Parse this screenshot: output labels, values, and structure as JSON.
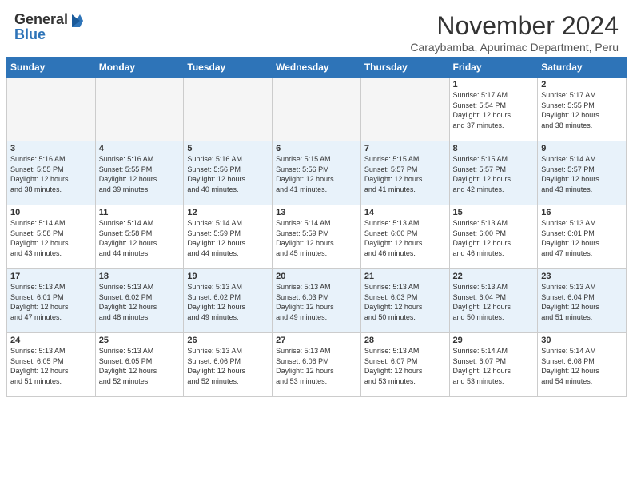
{
  "header": {
    "logo_general": "General",
    "logo_blue": "Blue",
    "title": "November 2024",
    "location": "Caraybamba, Apurimac Department, Peru"
  },
  "weekdays": [
    "Sunday",
    "Monday",
    "Tuesday",
    "Wednesday",
    "Thursday",
    "Friday",
    "Saturday"
  ],
  "weeks": [
    [
      {
        "day": "",
        "sunrise": "",
        "sunset": "",
        "daylight": ""
      },
      {
        "day": "",
        "sunrise": "",
        "sunset": "",
        "daylight": ""
      },
      {
        "day": "",
        "sunrise": "",
        "sunset": "",
        "daylight": ""
      },
      {
        "day": "",
        "sunrise": "",
        "sunset": "",
        "daylight": ""
      },
      {
        "day": "",
        "sunrise": "",
        "sunset": "",
        "daylight": ""
      },
      {
        "day": "1",
        "sunrise": "Sunrise: 5:17 AM",
        "sunset": "Sunset: 5:54 PM",
        "daylight": "Daylight: 12 hours and 37 minutes."
      },
      {
        "day": "2",
        "sunrise": "Sunrise: 5:17 AM",
        "sunset": "Sunset: 5:55 PM",
        "daylight": "Daylight: 12 hours and 38 minutes."
      }
    ],
    [
      {
        "day": "3",
        "sunrise": "Sunrise: 5:16 AM",
        "sunset": "Sunset: 5:55 PM",
        "daylight": "Daylight: 12 hours and 38 minutes."
      },
      {
        "day": "4",
        "sunrise": "Sunrise: 5:16 AM",
        "sunset": "Sunset: 5:55 PM",
        "daylight": "Daylight: 12 hours and 39 minutes."
      },
      {
        "day": "5",
        "sunrise": "Sunrise: 5:16 AM",
        "sunset": "Sunset: 5:56 PM",
        "daylight": "Daylight: 12 hours and 40 minutes."
      },
      {
        "day": "6",
        "sunrise": "Sunrise: 5:15 AM",
        "sunset": "Sunset: 5:56 PM",
        "daylight": "Daylight: 12 hours and 41 minutes."
      },
      {
        "day": "7",
        "sunrise": "Sunrise: 5:15 AM",
        "sunset": "Sunset: 5:57 PM",
        "daylight": "Daylight: 12 hours and 41 minutes."
      },
      {
        "day": "8",
        "sunrise": "Sunrise: 5:15 AM",
        "sunset": "Sunset: 5:57 PM",
        "daylight": "Daylight: 12 hours and 42 minutes."
      },
      {
        "day": "9",
        "sunrise": "Sunrise: 5:14 AM",
        "sunset": "Sunset: 5:57 PM",
        "daylight": "Daylight: 12 hours and 43 minutes."
      }
    ],
    [
      {
        "day": "10",
        "sunrise": "Sunrise: 5:14 AM",
        "sunset": "Sunset: 5:58 PM",
        "daylight": "Daylight: 12 hours and 43 minutes."
      },
      {
        "day": "11",
        "sunrise": "Sunrise: 5:14 AM",
        "sunset": "Sunset: 5:58 PM",
        "daylight": "Daylight: 12 hours and 44 minutes."
      },
      {
        "day": "12",
        "sunrise": "Sunrise: 5:14 AM",
        "sunset": "Sunset: 5:59 PM",
        "daylight": "Daylight: 12 hours and 44 minutes."
      },
      {
        "day": "13",
        "sunrise": "Sunrise: 5:14 AM",
        "sunset": "Sunset: 5:59 PM",
        "daylight": "Daylight: 12 hours and 45 minutes."
      },
      {
        "day": "14",
        "sunrise": "Sunrise: 5:13 AM",
        "sunset": "Sunset: 6:00 PM",
        "daylight": "Daylight: 12 hours and 46 minutes."
      },
      {
        "day": "15",
        "sunrise": "Sunrise: 5:13 AM",
        "sunset": "Sunset: 6:00 PM",
        "daylight": "Daylight: 12 hours and 46 minutes."
      },
      {
        "day": "16",
        "sunrise": "Sunrise: 5:13 AM",
        "sunset": "Sunset: 6:01 PM",
        "daylight": "Daylight: 12 hours and 47 minutes."
      }
    ],
    [
      {
        "day": "17",
        "sunrise": "Sunrise: 5:13 AM",
        "sunset": "Sunset: 6:01 PM",
        "daylight": "Daylight: 12 hours and 47 minutes."
      },
      {
        "day": "18",
        "sunrise": "Sunrise: 5:13 AM",
        "sunset": "Sunset: 6:02 PM",
        "daylight": "Daylight: 12 hours and 48 minutes."
      },
      {
        "day": "19",
        "sunrise": "Sunrise: 5:13 AM",
        "sunset": "Sunset: 6:02 PM",
        "daylight": "Daylight: 12 hours and 49 minutes."
      },
      {
        "day": "20",
        "sunrise": "Sunrise: 5:13 AM",
        "sunset": "Sunset: 6:03 PM",
        "daylight": "Daylight: 12 hours and 49 minutes."
      },
      {
        "day": "21",
        "sunrise": "Sunrise: 5:13 AM",
        "sunset": "Sunset: 6:03 PM",
        "daylight": "Daylight: 12 hours and 50 minutes."
      },
      {
        "day": "22",
        "sunrise": "Sunrise: 5:13 AM",
        "sunset": "Sunset: 6:04 PM",
        "daylight": "Daylight: 12 hours and 50 minutes."
      },
      {
        "day": "23",
        "sunrise": "Sunrise: 5:13 AM",
        "sunset": "Sunset: 6:04 PM",
        "daylight": "Daylight: 12 hours and 51 minutes."
      }
    ],
    [
      {
        "day": "24",
        "sunrise": "Sunrise: 5:13 AM",
        "sunset": "Sunset: 6:05 PM",
        "daylight": "Daylight: 12 hours and 51 minutes."
      },
      {
        "day": "25",
        "sunrise": "Sunrise: 5:13 AM",
        "sunset": "Sunset: 6:05 PM",
        "daylight": "Daylight: 12 hours and 52 minutes."
      },
      {
        "day": "26",
        "sunrise": "Sunrise: 5:13 AM",
        "sunset": "Sunset: 6:06 PM",
        "daylight": "Daylight: 12 hours and 52 minutes."
      },
      {
        "day": "27",
        "sunrise": "Sunrise: 5:13 AM",
        "sunset": "Sunset: 6:06 PM",
        "daylight": "Daylight: 12 hours and 53 minutes."
      },
      {
        "day": "28",
        "sunrise": "Sunrise: 5:13 AM",
        "sunset": "Sunset: 6:07 PM",
        "daylight": "Daylight: 12 hours and 53 minutes."
      },
      {
        "day": "29",
        "sunrise": "Sunrise: 5:14 AM",
        "sunset": "Sunset: 6:07 PM",
        "daylight": "Daylight: 12 hours and 53 minutes."
      },
      {
        "day": "30",
        "sunrise": "Sunrise: 5:14 AM",
        "sunset": "Sunset: 6:08 PM",
        "daylight": "Daylight: 12 hours and 54 minutes."
      }
    ]
  ]
}
